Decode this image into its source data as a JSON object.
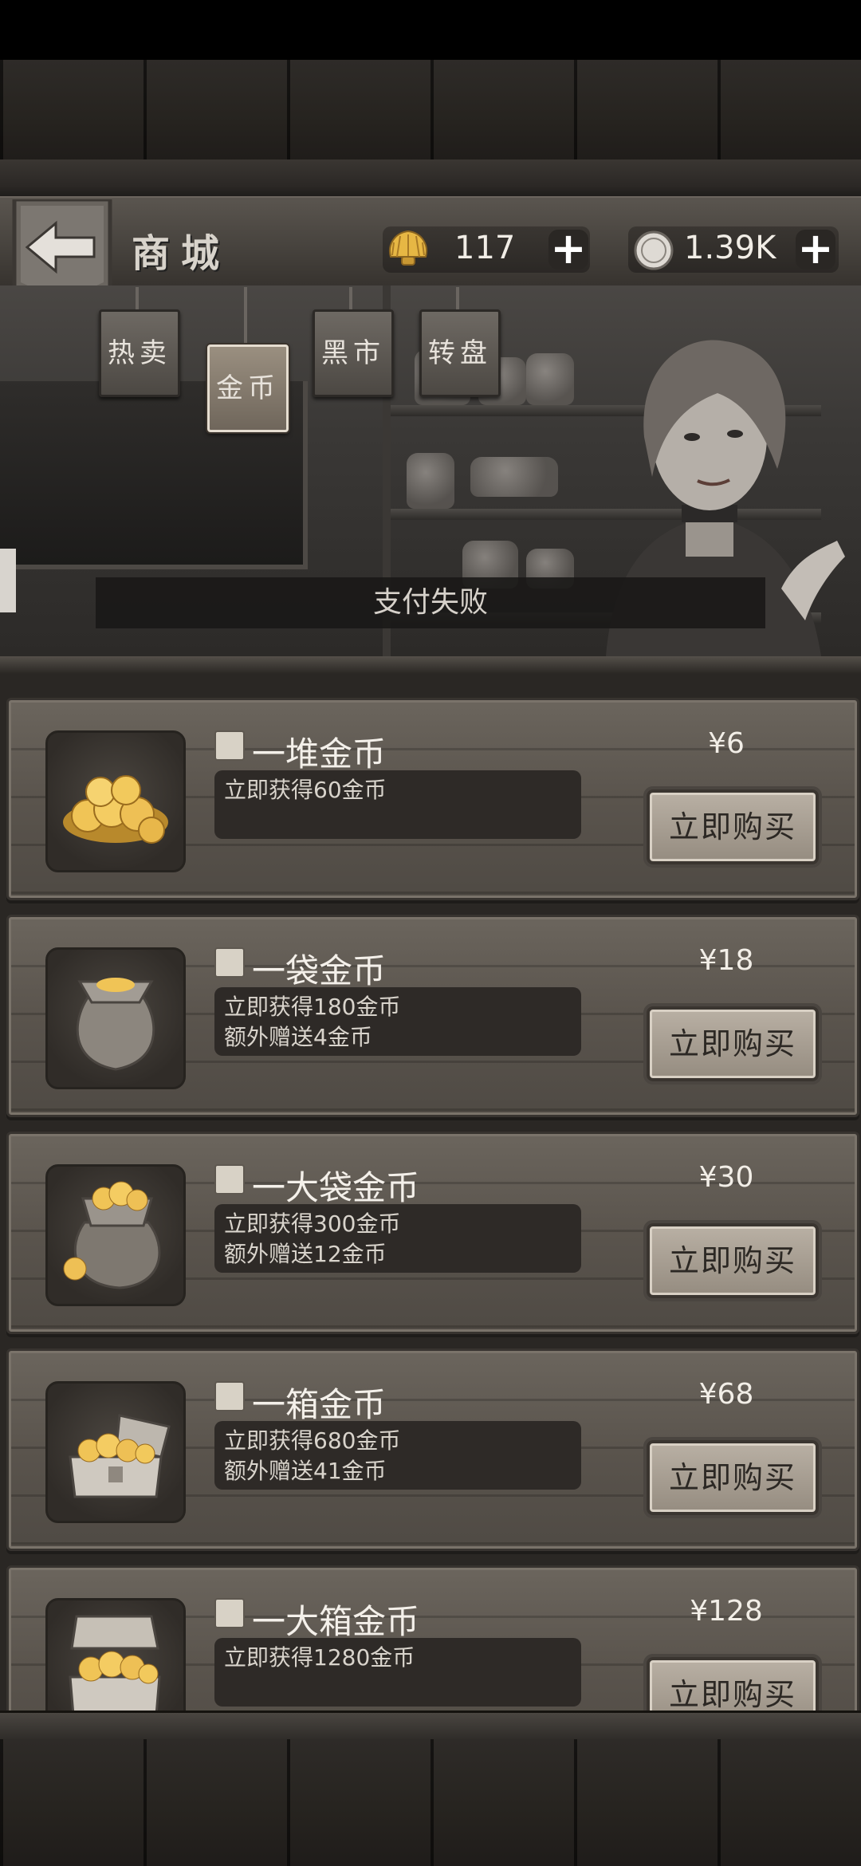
{
  "header": {
    "title": "商城",
    "shells": "117",
    "coins": "1.39K"
  },
  "tabs": [
    {
      "label": "热卖",
      "active": false
    },
    {
      "label": "金币",
      "active": true
    },
    {
      "label": "黑市",
      "active": false
    },
    {
      "label": "转盘",
      "active": false
    }
  ],
  "toast": "支付失败",
  "products": [
    {
      "name": "一堆金币",
      "price": "¥6",
      "line1": "立即获得60金币",
      "line2": "",
      "buy": "立即购买",
      "icon": "coin-pile-icon"
    },
    {
      "name": "一袋金币",
      "price": "¥18",
      "line1": "立即获得180金币",
      "line2": "额外赠送4金币",
      "buy": "立即购买",
      "icon": "coin-bag-icon"
    },
    {
      "name": "一大袋金币",
      "price": "¥30",
      "line1": "立即获得300金币",
      "line2": "额外赠送12金币",
      "buy": "立即购买",
      "icon": "big-coin-bag-icon"
    },
    {
      "name": "一箱金币",
      "price": "¥68",
      "line1": "立即获得680金币",
      "line2": "额外赠送41金币",
      "buy": "立即购买",
      "icon": "coin-chest-icon"
    },
    {
      "name": "一大箱金币",
      "price": "¥128",
      "line1": "立即获得1280金币",
      "line2": "",
      "buy": "立即购买",
      "icon": "big-coin-chest-icon"
    }
  ],
  "colors": {
    "accent_gold": "#e6b94a",
    "wood_dark": "#2e2b28",
    "button_face": "#b9b0a4"
  }
}
